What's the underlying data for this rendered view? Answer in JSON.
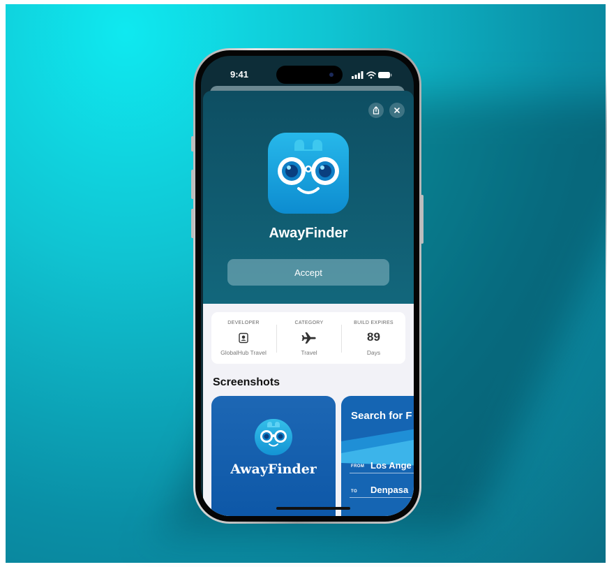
{
  "status_bar": {
    "time": "9:41"
  },
  "sheet": {
    "share_icon": "share-icon",
    "close_icon": "close-icon",
    "app_name": "AwayFinder",
    "accept_label": "Accept"
  },
  "info": {
    "developer": {
      "title": "DEVELOPER",
      "icon": "person-badge-icon",
      "value": "GlobalHub Travel"
    },
    "category": {
      "title": "CATEGORY",
      "icon": "airplane-icon",
      "value": "Travel"
    },
    "build_expires": {
      "title": "BUILD EXPIRES",
      "value": "89",
      "unit": "Days"
    }
  },
  "screenshots": {
    "title": "Screenshots",
    "items": [
      {
        "app_name": "AwayFinder"
      },
      {
        "heading": "Search for F",
        "from_label": "FROM",
        "from_value": "Los Ange",
        "to_label": "TO",
        "to_value": "Denpasa"
      }
    ]
  },
  "colors": {
    "background": "#10c4d2",
    "sheet_top": "#0e4e62",
    "icon_blue": "#0d8cd0",
    "screenshot_blue": "#0b55a5"
  }
}
